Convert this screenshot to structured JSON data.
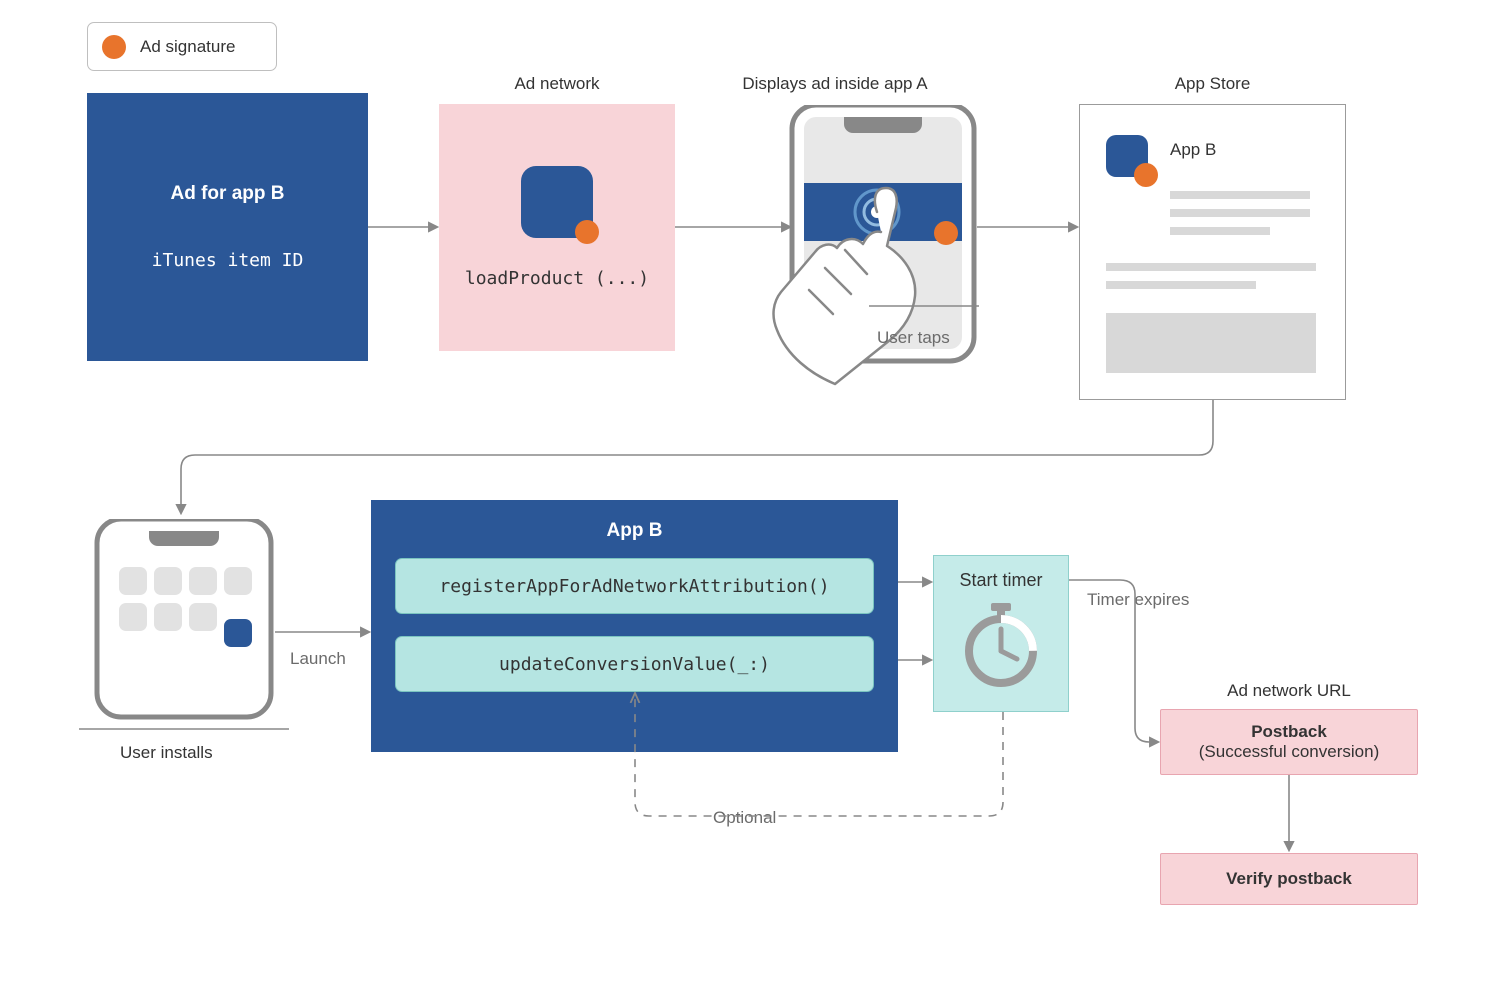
{
  "legend": {
    "label": "Ad signature"
  },
  "headings": {
    "ad_network": "Ad network",
    "displays": "Displays ad inside app A",
    "app_store": "App Store"
  },
  "ad_box": {
    "title": "Ad for app B",
    "item_id": "iTunes item ID"
  },
  "adnet": {
    "code": "loadProduct (...)"
  },
  "phoneA": {
    "user_taps": "User taps"
  },
  "appstore": {
    "app_name": "App B"
  },
  "phoneB": {
    "user_installs": "User installs",
    "launch": "Launch"
  },
  "appB": {
    "title": "App B",
    "register": "registerAppForAdNetworkAttribution()",
    "update": "updateConversionValue(_:)"
  },
  "timer": {
    "label": "Start timer",
    "expires": "Timer expires"
  },
  "adneturl": "Ad network URL",
  "postback": {
    "title": "Postback",
    "sub": "(Successful conversion)"
  },
  "verify": "Verify postback",
  "optional": "Optional"
}
